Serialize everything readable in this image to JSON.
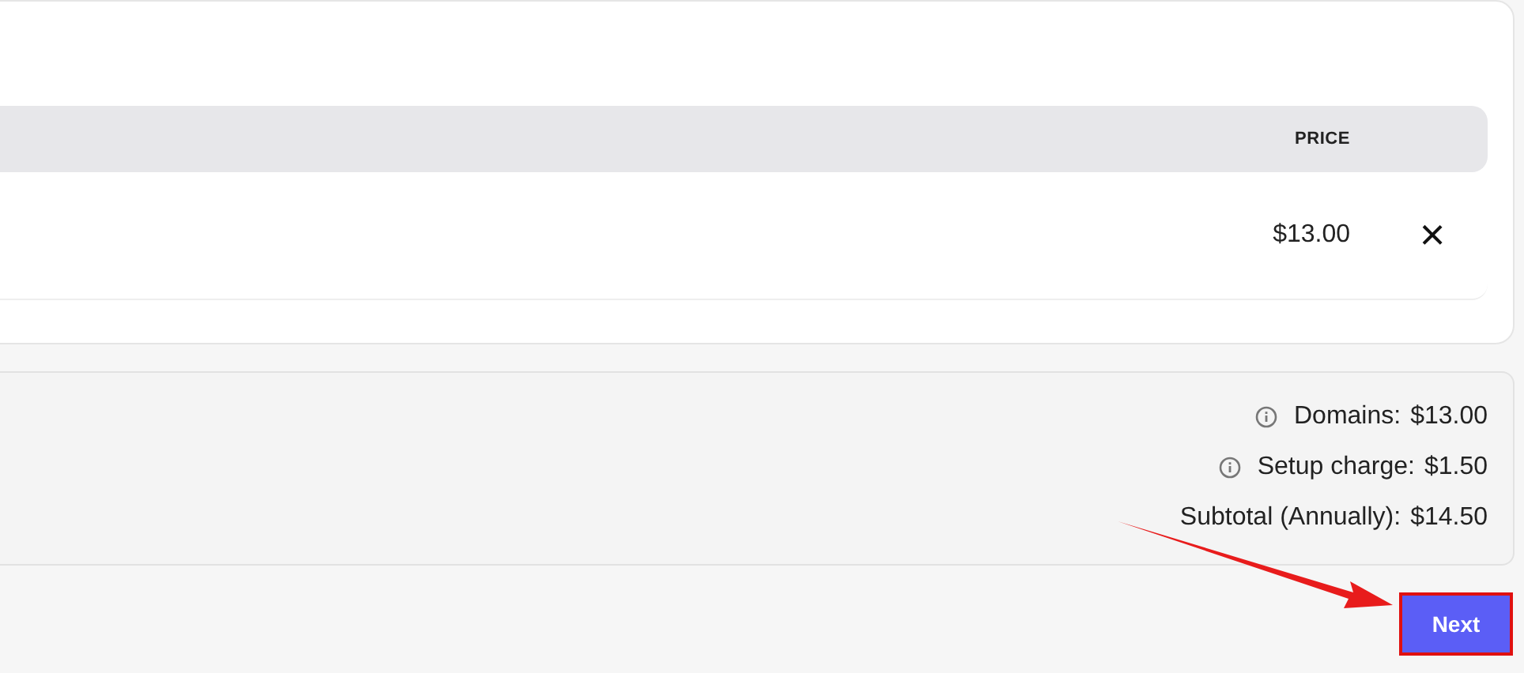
{
  "table": {
    "columns": [
      {
        "label": "PRICE"
      }
    ],
    "rows": [
      {
        "price": "$13.00",
        "remove": "×"
      }
    ]
  },
  "summary": {
    "lines": [
      {
        "kind": "info",
        "label": "Domains:",
        "value": "$13.00"
      },
      {
        "kind": "info",
        "label": "Setup charge:",
        "value": "$1.50"
      },
      {
        "kind": "plain",
        "label": "Subtotal (Annually):",
        "value": "$14.50"
      }
    ]
  },
  "next_button": {
    "label": "Next"
  }
}
